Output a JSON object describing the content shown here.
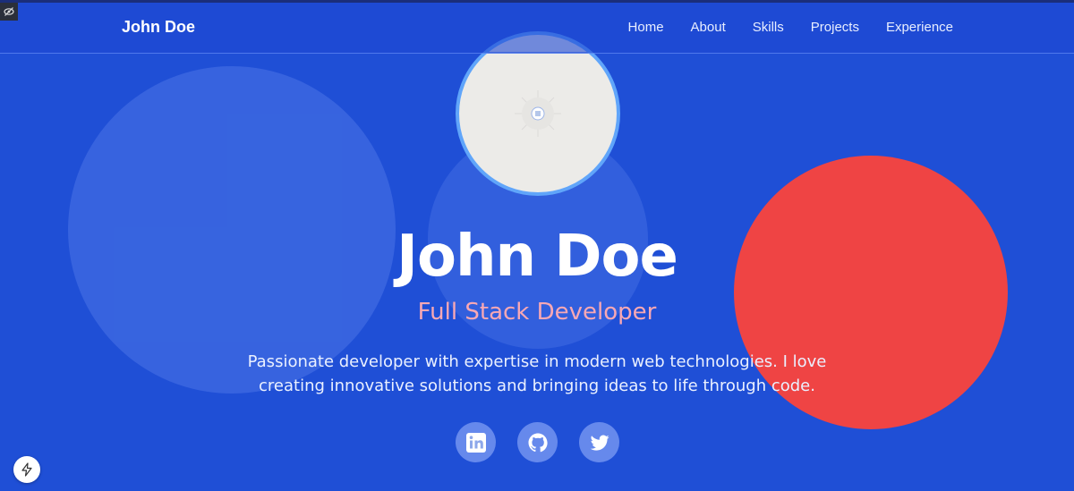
{
  "nav": {
    "brand": "John Doe",
    "links": [
      "Home",
      "About",
      "Skills",
      "Projects",
      "Experience"
    ]
  },
  "hero": {
    "name": "John Doe",
    "role": "Full Stack Developer",
    "description": "Passionate developer with expertise in modern web technologies. I love creating innovative solutions and bringing ideas to life through code."
  },
  "socials": [
    {
      "icon": "linkedin-icon"
    },
    {
      "icon": "github-icon"
    },
    {
      "icon": "twitter-icon"
    }
  ],
  "colors": {
    "background": "#1f4fd6",
    "accent_red": "#ef4444",
    "role_text": "#f9a8b4",
    "avatar_border": "#60a5fa"
  }
}
